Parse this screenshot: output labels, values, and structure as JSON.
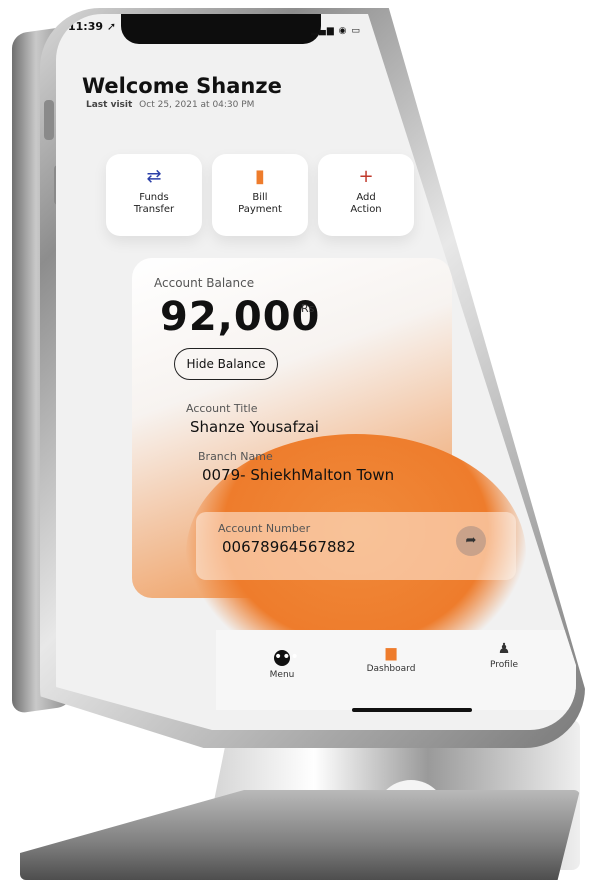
{
  "status_bar": {
    "time": "11:39 ➚",
    "icons": "▂▄▆ ◉ ▭"
  },
  "header": {
    "welcome": "Welcome Shanze",
    "last_visit_label": "Last visit",
    "last_visit_value": "Oct 25, 2021 at 04:30 PM"
  },
  "quick_actions": [
    {
      "label": "Funds\nTransfer",
      "icon": "transfer-icon",
      "glyph": "⇄"
    },
    {
      "label": "Bill\nPayment",
      "icon": "bill-icon",
      "glyph": "▮"
    },
    {
      "label": "Add\nAction",
      "icon": "plus-icon",
      "glyph": "+"
    }
  ],
  "balance": {
    "label": "Account Balance",
    "value": "92,000",
    "unit": "Rs",
    "hide_button": "Hide Balance"
  },
  "account": {
    "title_label": "Account Title",
    "title_value": "Shanze Yousafzai",
    "branch_label": "Branch Name",
    "branch_value": "0079- ShiekhMalton Town",
    "number_label": "Account Number",
    "number_value": "00678964567882"
  },
  "nav": {
    "menu": "Menu",
    "dashboard": "Dashboard",
    "profile": "Profile"
  },
  "colors": {
    "accent": "#ee7c2c",
    "transfer_icon": "#2b3fa8",
    "plus_icon": "#c0392b"
  }
}
